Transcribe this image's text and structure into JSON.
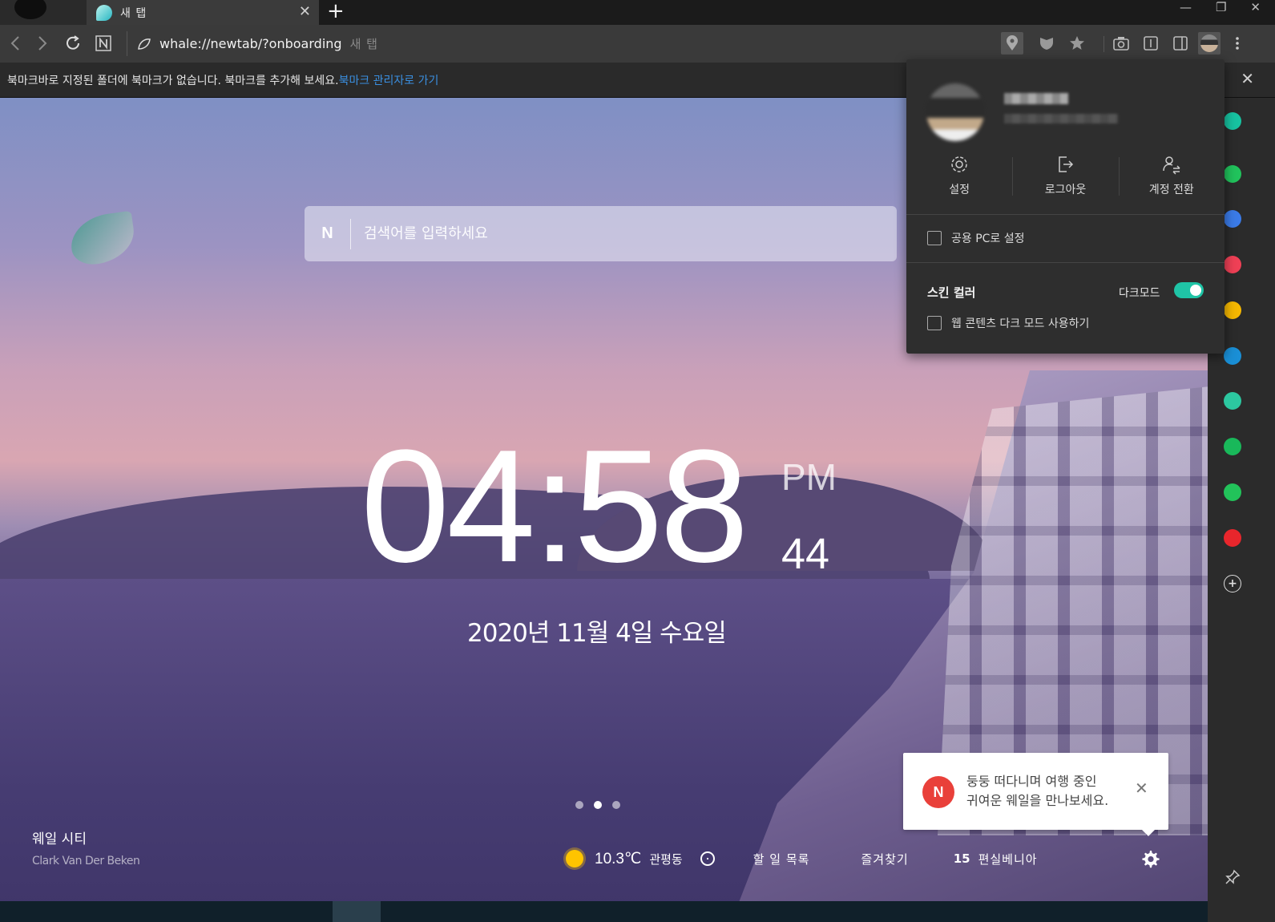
{
  "browser": {
    "tab": {
      "title": "새 탭"
    },
    "url": "whale://newtab/?onboarding",
    "url_hint": "새 탭"
  },
  "bookmark_bar": {
    "message": "북마크바로 지정된 폴더에 북마크가 없습니다. 북마크를 추가해 보세요.",
    "link": "북마크 관리자로 가기"
  },
  "search": {
    "placeholder": "검색어를 입력하세요",
    "logo": "N"
  },
  "clock": {
    "hm": "04:58",
    "ampm": "PM",
    "seconds": "44",
    "date": "2020년 11월 4일 수요일"
  },
  "pager": {
    "count": 3,
    "active": 2
  },
  "credit": {
    "title": "웨일 시티",
    "author": "Clark Van Der Beken"
  },
  "widgets": {
    "temperature": "10.3℃",
    "location": "관평동",
    "todo": "할 일 목록",
    "favorites": "즐겨찾기",
    "notice_count": "15",
    "notice_label": "편실베니아"
  },
  "toast": {
    "icon_letter": "N",
    "line1": "둥둥 떠다니며 여행 중인",
    "line2": "귀여운 웨일을 만나보세요."
  },
  "profile_popup": {
    "actions": [
      {
        "label": "설정",
        "icon": "gear-icon"
      },
      {
        "label": "로그아웃",
        "icon": "logout-icon"
      },
      {
        "label": "계정 전환",
        "icon": "switch-account-icon"
      }
    ],
    "shared_pc": "공용 PC로 설정",
    "skin_color": "스킨 컬러",
    "dark_mode": "다크모드",
    "dark_mode_on": true,
    "web_dark_mode": "웹 콘텐츠 다크 모드 사용하기"
  },
  "sidebar": {
    "items": [
      {
        "name": "green-circle-app-icon",
        "color": "#17c3a1"
      },
      {
        "name": "bell-app-icon",
        "color": "#21c35c"
      },
      {
        "name": "toolbox-app-icon",
        "color": "#3b7be8"
      },
      {
        "name": "pocket-app-icon",
        "color": "#ef4056"
      },
      {
        "name": "star-app-icon",
        "color": "#f6b800"
      },
      {
        "name": "edge-app-icon",
        "color": "#1a8fd6"
      },
      {
        "name": "play-app-icon",
        "color": "#2cc7a0"
      },
      {
        "name": "webtoon-app-icon",
        "color": "#19b85a"
      },
      {
        "name": "green-square-app-icon",
        "color": "#22c35a"
      },
      {
        "name": "now-app-icon",
        "color": "#e8262c"
      }
    ]
  },
  "colors": {
    "accent": "#1fc4a6",
    "link": "#3a8fe0",
    "toast_icon": "#e9403a"
  }
}
